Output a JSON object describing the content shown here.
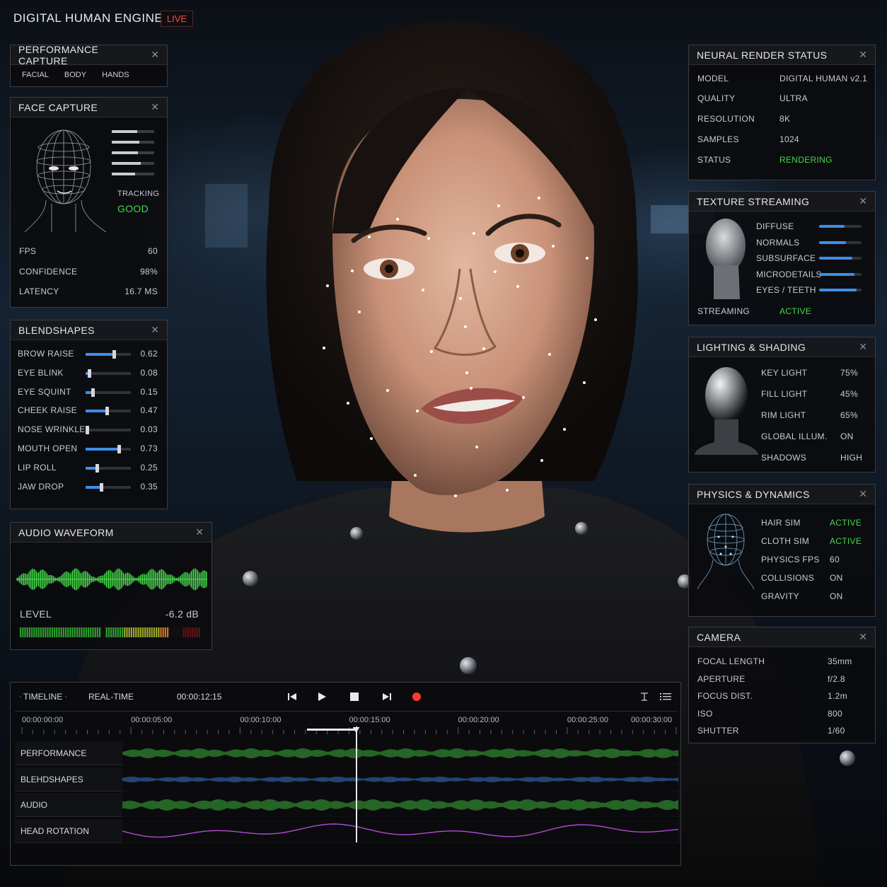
{
  "header": {
    "app_title": "DIGITAL HUMAN ENGINE",
    "live_badge": "LIVE"
  },
  "colors": {
    "accent_blue": "#3d8ee8",
    "status_green": "#45d94a",
    "live_red": "#ff4a3c"
  },
  "performance_capture": {
    "title": "PERFORMANCE CAPTURE",
    "tabs": [
      "FACIAL",
      "BODY",
      "HANDS"
    ]
  },
  "face_capture": {
    "title": "FACE CAPTURE",
    "tracking_label": "TRACKING",
    "tracking_value": "GOOD",
    "rows": [
      {
        "label": "FPS",
        "value": "60"
      },
      {
        "label": "CONFIDENCE",
        "value": "98%"
      },
      {
        "label": "LATENCY",
        "value": "16.7 MS"
      }
    ]
  },
  "blendshapes": {
    "title": "BLENDSHAPES",
    "items": [
      {
        "label": "BROW RAISE",
        "value": "0.62",
        "level": 0.62
      },
      {
        "label": "EYE BLINK",
        "value": "0.08",
        "level": 0.08
      },
      {
        "label": "EYE SQUINT",
        "value": "0.15",
        "level": 0.15
      },
      {
        "label": "CHEEK RAISE",
        "value": "0.47",
        "level": 0.47
      },
      {
        "label": "NOSE WRINKLE",
        "value": "0.03",
        "level": 0.03
      },
      {
        "label": "MOUTH OPEN",
        "value": "0.73",
        "level": 0.73
      },
      {
        "label": "LIP ROLL",
        "value": "0.25",
        "level": 0.25
      },
      {
        "label": "JAW DROP",
        "value": "0.35",
        "level": 0.35
      }
    ]
  },
  "audio_waveform": {
    "title": "AUDIO WAVEFORM",
    "level_label": "LEVEL",
    "level_value": "-6.2 dB"
  },
  "neural_render": {
    "title": "NEURAL RENDER STATUS",
    "rows": [
      {
        "label": "MODEL",
        "value": "DIGITAL HUMAN v2.1"
      },
      {
        "label": "QUALITY",
        "value": "ULTRA"
      },
      {
        "label": "RESOLUTION",
        "value": "8K"
      },
      {
        "label": "SAMPLES",
        "value": "1024"
      },
      {
        "label": "STATUS",
        "value": "RENDERING"
      }
    ]
  },
  "texture_streaming": {
    "title": "TEXTURE STREAMING",
    "items": [
      {
        "label": "DIFFUSE",
        "level": 0.6
      },
      {
        "label": "NORMALS",
        "level": 0.63
      },
      {
        "label": "SUBSURFACE",
        "level": 0.78
      },
      {
        "label": "MICRODETAILS",
        "level": 0.83
      },
      {
        "label": "EYES / TEETH",
        "level": 0.88
      }
    ],
    "streaming_label": "STREAMING",
    "streaming_value": "ACTIVE"
  },
  "lighting": {
    "title": "LIGHTING & SHADING",
    "rows": [
      {
        "label": "KEY LIGHT",
        "value": "75%"
      },
      {
        "label": "FILL LIGHT",
        "value": "45%"
      },
      {
        "label": "RIM LIGHT",
        "value": "65%"
      },
      {
        "label": "GLOBAL ILLUM.",
        "value": "ON"
      },
      {
        "label": "SHADOWS",
        "value": "HIGH"
      }
    ]
  },
  "physics": {
    "title": "PHYSICS & DYNAMICS",
    "rows": [
      {
        "label": "HAIR SIM",
        "value": "ACTIVE"
      },
      {
        "label": "CLOTH SIM",
        "value": "ACTIVE"
      },
      {
        "label": "PHYSICS FPS",
        "value": "60"
      },
      {
        "label": "COLLISIONS",
        "value": "ON"
      },
      {
        "label": "GRAVITY",
        "value": "ON"
      }
    ]
  },
  "camera": {
    "title": "CAMERA",
    "rows": [
      {
        "label": "FOCAL LENGTH",
        "value": "35mm"
      },
      {
        "label": "APERTURE",
        "value": "f/2.8"
      },
      {
        "label": "FOCUS DIST.",
        "value": "1.2m"
      },
      {
        "label": "ISO",
        "value": "800"
      },
      {
        "label": "SHUTTER",
        "value": "1/60"
      }
    ]
  },
  "timeline": {
    "label": "TIMELINE",
    "mode": "REAL-TIME",
    "timecode": "00:00:12:15",
    "ticks": [
      "00:00:00:00",
      "00:00:05:00",
      "00:00:10:00",
      "00:00:15:00",
      "00:00:20:00",
      "00:00:25:00",
      "00:00:30:00"
    ],
    "playhead_seconds": 15,
    "tracks": [
      "PERFORMANCE",
      "BLEHDSHAPES",
      "AUDIO",
      "HEAD ROTATION"
    ]
  }
}
